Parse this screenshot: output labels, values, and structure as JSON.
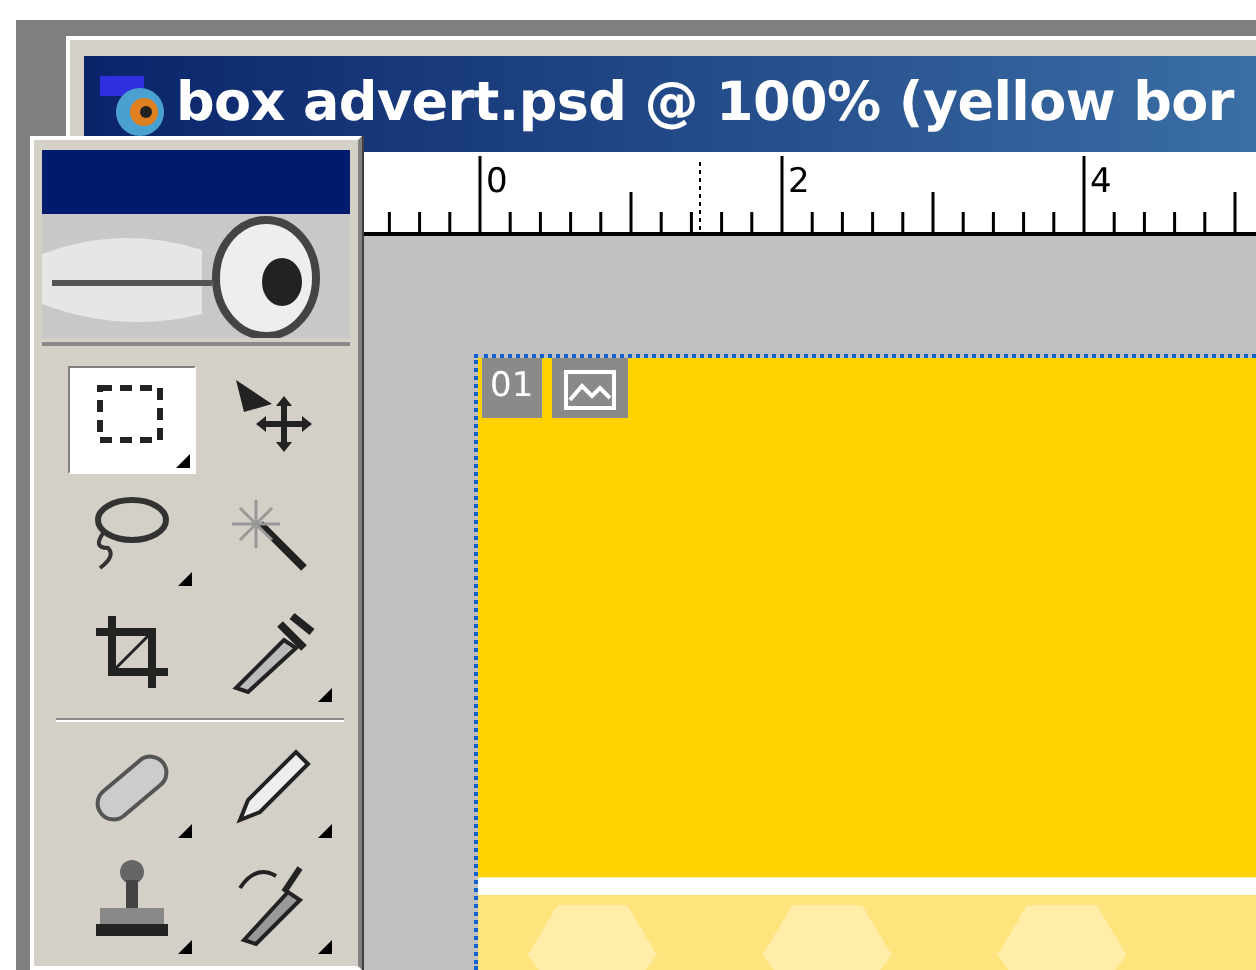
{
  "document_window": {
    "title": "box advert.psd @ 100% (yellow bor",
    "ruler": {
      "labels": [
        "0",
        "2",
        "4"
      ]
    },
    "slice": {
      "number": "01"
    }
  },
  "toolbox": {
    "tools": [
      {
        "kind": "marquee",
        "selected": true,
        "flyout": true
      },
      {
        "kind": "move",
        "selected": false,
        "flyout": false
      },
      {
        "kind": "lasso",
        "selected": false,
        "flyout": true
      },
      {
        "kind": "wand",
        "selected": false,
        "flyout": false
      },
      {
        "kind": "crop",
        "selected": false,
        "flyout": false
      },
      {
        "kind": "slice",
        "selected": false,
        "flyout": true
      },
      {
        "kind": "divider"
      },
      {
        "kind": "bandage",
        "selected": false,
        "flyout": true
      },
      {
        "kind": "pencil",
        "selected": false,
        "flyout": true
      },
      {
        "kind": "stamp",
        "selected": false,
        "flyout": true
      },
      {
        "kind": "history",
        "selected": false,
        "flyout": true
      }
    ]
  }
}
